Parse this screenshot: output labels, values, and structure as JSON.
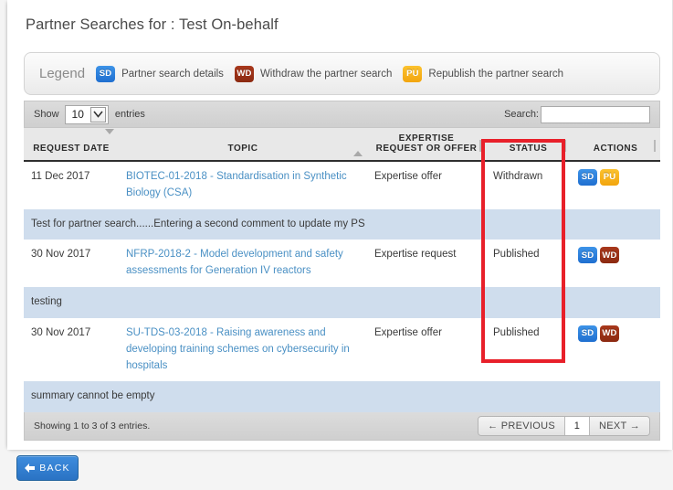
{
  "page": {
    "title": "Partner Searches for : Test On-behalf"
  },
  "legend": {
    "title": "Legend",
    "items": [
      {
        "code": "SD",
        "label": "Partner search details",
        "color": "#2a7fd4"
      },
      {
        "code": "WD",
        "label": "Withdraw the partner search",
        "color": "#97300f"
      },
      {
        "code": "PU",
        "label": "Republish the partner search",
        "color": "#f5ab1a"
      }
    ]
  },
  "toolbar": {
    "show_label": "Show",
    "entries_label": "entries",
    "page_size": "10",
    "search_label": "Search:",
    "search_value": "",
    "search_placeholder": ""
  },
  "table": {
    "columns": [
      {
        "label": "REQUEST DATE",
        "sort": "desc"
      },
      {
        "label": "TOPIC",
        "sort": "asc"
      },
      {
        "label": "EXPERTISE REQUEST OR OFFER",
        "sort": "none"
      },
      {
        "label": "STATUS",
        "sort": "none"
      },
      {
        "label": "ACTIONS",
        "sort": "none"
      }
    ],
    "rows": [
      {
        "type": "data",
        "date": "11 Dec 2017",
        "topic": "BIOTEC-01-2018 - Standardisation in Synthetic Biology (CSA)",
        "expertise": "Expertise offer",
        "status": "Withdrawn",
        "actions": [
          "SD",
          "PU"
        ]
      },
      {
        "type": "comment",
        "text": "Test for partner search......Entering a second comment to update my PS"
      },
      {
        "type": "data",
        "date": "30 Nov 2017",
        "topic": "NFRP-2018-2 - Model development and safety assessments for Generation IV reactors",
        "expertise": "Expertise request",
        "status": "Published",
        "actions": [
          "SD",
          "WD"
        ]
      },
      {
        "type": "comment",
        "text": "testing"
      },
      {
        "type": "data",
        "date": "30 Nov 2017",
        "topic": "SU-TDS-03-2018 - Raising awareness and developing training schemes on cybersecurity in hospitals",
        "expertise": "Expertise offer",
        "status": "Published",
        "actions": [
          "SD",
          "WD"
        ]
      },
      {
        "type": "comment",
        "text": "summary cannot be empty"
      }
    ]
  },
  "footer": {
    "info": "Showing 1 to 3 of 3 entries.",
    "previous": "← PREVIOUS",
    "page_number": "1",
    "next": "NEXT →"
  },
  "back_button": {
    "label": "BACK"
  },
  "annotation": {
    "highlight_color": "#e8202a",
    "highlights_column": "STATUS"
  }
}
